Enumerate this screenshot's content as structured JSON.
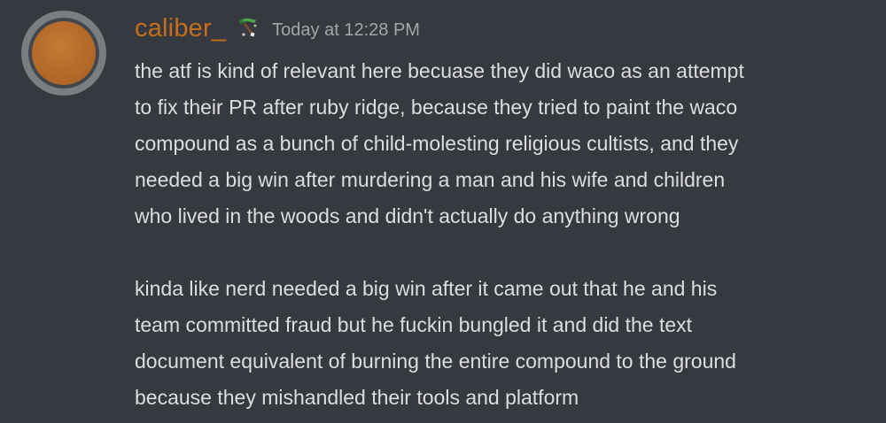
{
  "message": {
    "author": "caliber_",
    "role_icon": "pickaxe-icon",
    "timestamp": "Today at 12:28 PM",
    "paragraphs": [
      "the atf is kind of relevant here becuase they did waco as an attempt\nto fix their PR after ruby ridge, because they tried to paint the waco\ncompound as a bunch of child-molesting religious cultists, and they\nneeded a big win after murdering a man and his wife and children\nwho lived in the woods and didn't actually do anything wrong",
      "kinda like nerd needed a big win after it came out that he and his\nteam committed fraud but he fuckin bungled it and did the text\ndocument equivalent of burning the entire compound to the ground\nbecause they mishandled their tools and platform"
    ]
  },
  "colors": {
    "background": "#36393f",
    "username": "#c56e1c",
    "timestamp": "#a3a6aa",
    "text": "#dcddde",
    "avatar": "#b5692a"
  }
}
